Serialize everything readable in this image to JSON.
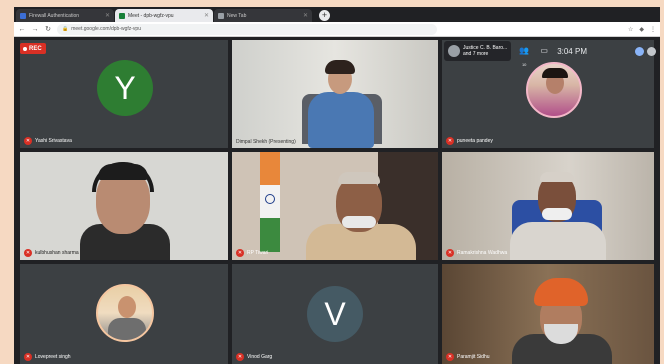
{
  "browser": {
    "tabs": [
      {
        "title": "Firewall Authentication",
        "favicon_color": "#3c6fd6",
        "active": false
      },
      {
        "title": "Meet - dpb-wgfz-vpu",
        "favicon_color": "#188038",
        "active": true
      },
      {
        "title": "New Tab",
        "favicon_color": "#9aa0a6",
        "active": false
      }
    ],
    "new_tab_label": "+",
    "url": "meet.google.com/dpb-wgfz-vpu"
  },
  "meet": {
    "rec_label": "REC",
    "presenter": {
      "line1": "Justice C. B. Baro...",
      "line2": "and 7 more"
    },
    "participants_count": "10",
    "time": "3:04 PM"
  },
  "participants": [
    {
      "name": "Yashi Srivastava",
      "kind": "letter",
      "letter": "Y",
      "color": "#2e7d32"
    },
    {
      "name": "Dimpal Shekh (Presenting)",
      "kind": "video"
    },
    {
      "name": "puneeta pandey",
      "kind": "photo"
    },
    {
      "name": "kulbhushan sharma",
      "kind": "video"
    },
    {
      "name": "RP Tiwari",
      "kind": "video"
    },
    {
      "name": "Ramakrishna Wadhwa",
      "kind": "video"
    },
    {
      "name": "Lovepreet singh",
      "kind": "photo"
    },
    {
      "name": "Vinod Garg",
      "kind": "letter",
      "letter": "V",
      "color": "#455a64"
    },
    {
      "name": "Paramjit Sidhu",
      "kind": "video"
    }
  ],
  "colors": {
    "page_bg": "#f6d9c2",
    "meet_bg": "#202124",
    "tile_bg": "#3c4043",
    "mic_off": "#d93025"
  }
}
